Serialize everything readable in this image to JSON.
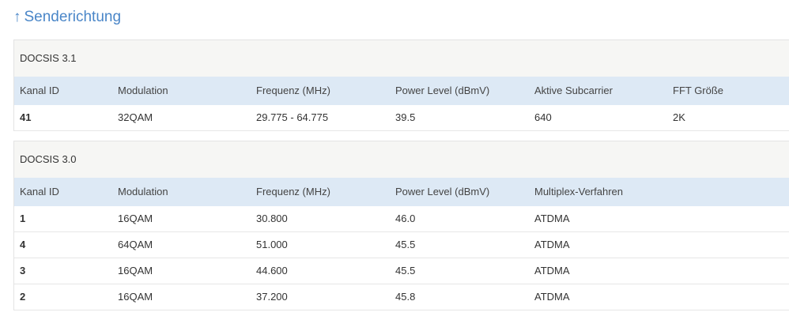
{
  "section": {
    "arrow": "↑",
    "title": "Senderichtung"
  },
  "docsis31": {
    "title": "DOCSIS 3.1",
    "headers": [
      "Kanal ID",
      "Modulation",
      "Frequenz (MHz)",
      "Power Level (dBmV)",
      "Aktive Subcarrier",
      "FFT Größe"
    ],
    "rows": [
      [
        "41",
        "32QAM",
        "29.775 - 64.775",
        "39.5",
        "640",
        "2K"
      ]
    ]
  },
  "docsis30": {
    "title": "DOCSIS 3.0",
    "headers": [
      "Kanal ID",
      "Modulation",
      "Frequenz (MHz)",
      "Power Level (dBmV)",
      "Multiplex-Verfahren"
    ],
    "rows": [
      [
        "1",
        "16QAM",
        "30.800",
        "46.0",
        "ATDMA"
      ],
      [
        "4",
        "64QAM",
        "51.000",
        "45.5",
        "ATDMA"
      ],
      [
        "3",
        "16QAM",
        "44.600",
        "45.5",
        "ATDMA"
      ],
      [
        "2",
        "16QAM",
        "37.200",
        "45.8",
        "ATDMA"
      ]
    ]
  },
  "colors": {
    "title": "#4a86c8",
    "header_row_bg": "#dde9f5",
    "block_header_bg": "#f6f6f4"
  },
  "icons": {
    "section_arrow": "arrow-up-icon"
  }
}
